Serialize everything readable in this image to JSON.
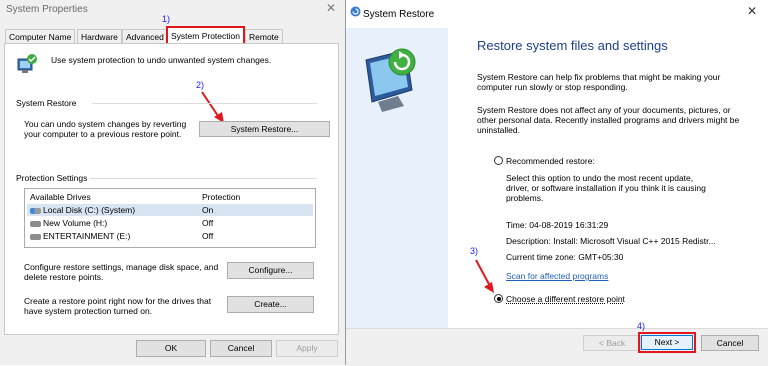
{
  "annotations": [
    "1)",
    "2)",
    "3)",
    "4)"
  ],
  "system_properties": {
    "title": "System Properties",
    "tabs": [
      "Computer Name",
      "Hardware",
      "Advanced",
      "System Protection",
      "Remote"
    ],
    "intro_text": "Use system protection to undo unwanted system changes.",
    "system_restore_section": "System Restore",
    "restore_desc_1": "You can undo system changes by reverting",
    "restore_desc_2": "your computer to a previous restore point.",
    "system_restore_button": "System Restore...",
    "protection_section": "Protection Settings",
    "drives_headers": [
      "Available Drives",
      "Protection"
    ],
    "drives": [
      {
        "name": "Local Disk (C:) (System)",
        "protection": "On"
      },
      {
        "name": "New Volume (H:)",
        "protection": "Off"
      },
      {
        "name": "ENTERTAINMENT (E:)",
        "protection": "Off"
      }
    ],
    "configure_desc_1": "Configure restore settings, manage disk space, and",
    "configure_desc_2": "delete restore points.",
    "configure_button": "Configure...",
    "create_desc_1": "Create a restore point right now for the drives that",
    "create_desc_2": "have system protection turned on.",
    "create_button": "Create...",
    "ok_button": "OK",
    "cancel_button": "Cancel",
    "apply_button": "Apply"
  },
  "system_restore": {
    "title": "System Restore",
    "heading": "Restore system files and settings",
    "para1_1": "System Restore can help fix problems that might be making your",
    "para1_2": "computer run slowly or stop responding.",
    "para2_1": "System Restore does not affect any of your documents, pictures, or",
    "para2_2": "other personal data. Recently installed programs and drivers might be",
    "para2_3": "uninstalled.",
    "recommended_label": "Recommended restore:",
    "recommended_desc_1": "Select this option to undo the most recent update,",
    "recommended_desc_2": "driver, or software installation if you think it is causing",
    "recommended_desc_3": "problems.",
    "time": "Time: 04-08-2019 16:31:29",
    "description": "Description: Install: Microsoft Visual C++ 2015 Redistr...",
    "timezone": "Current time zone: GMT+05:30",
    "scan_link": "Scan for affected programs",
    "choose_label": "Choose a different restore point",
    "back_button": "< Back",
    "next_button": "Next >",
    "cancel_button": "Cancel"
  }
}
